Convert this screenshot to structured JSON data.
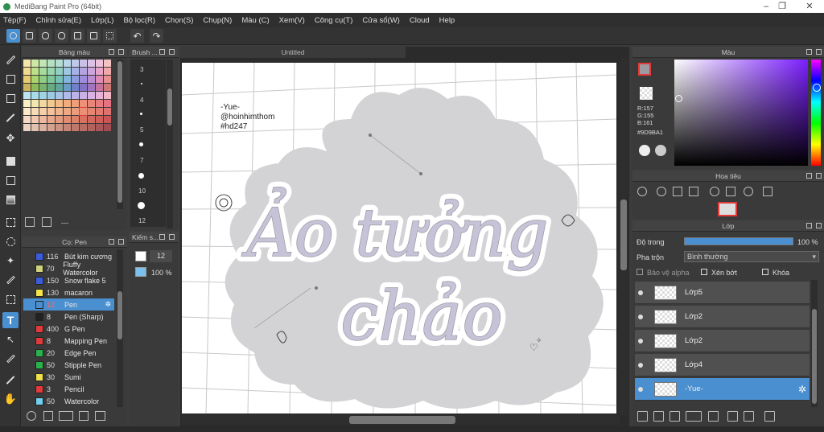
{
  "app": {
    "title": "MediBang Paint Pro (64bit)"
  },
  "menu": [
    "Tệp(F)",
    "Chỉnh sửa(E)",
    "Lớp(L)",
    "Bộ lọc(R)",
    "Chọn(S)",
    "Chụp(N)",
    "Màu (C)",
    "Xem(V)",
    "Công cụ(T)",
    "Cửa sổ(W)",
    "Cloud",
    "Help"
  ],
  "palette": {
    "title": "Bảng màu",
    "footer": "---",
    "colors": [
      "#f3e6a8",
      "#cde8a5",
      "#c1e6b5",
      "#b7e0c3",
      "#b2ddd0",
      "#b9d7e8",
      "#c0c8ea",
      "#cbc0e8",
      "#dcc0e6",
      "#efc2dc",
      "#f6c3c3",
      "#eedb8e",
      "#bfe08a",
      "#a6dc9c",
      "#98d6ae",
      "#92d0c3",
      "#9dc8e3",
      "#a4b2e6",
      "#b4a3e2",
      "#cda5dd",
      "#e7a5c9",
      "#f1a8a8",
      "#e5cc70",
      "#a9d46e",
      "#8ccf84",
      "#7ec79b",
      "#76c2b5",
      "#82b7dd",
      "#8d9ce0",
      "#9e8ddc",
      "#ba8dd3",
      "#dd8cb6",
      "#e88f8f",
      "#c8b45c",
      "#8dbb5a",
      "#77b46d",
      "#67ab83",
      "#5fa69c",
      "#6a9cc4",
      "#7181c9",
      "#8473c4",
      "#a174bd",
      "#c4749f",
      "#d07878",
      "#b9e4f0",
      "#a9dcea",
      "#a0d4e4",
      "#9ccce3",
      "#a6c3e8",
      "#afb9ea",
      "#bbb3ea",
      "#c9b0e6",
      "#d9b1e2",
      "#e8b3d8",
      "#f2b8c8",
      "#f7f0c2",
      "#f3e6b0",
      "#f2d89f",
      "#f2c98f",
      "#f3ba84",
      "#f2ab7c",
      "#f09d78",
      "#ed9178",
      "#ea857a",
      "#e87b7d",
      "#e57183",
      "#fbe9c8",
      "#f8dcb8",
      "#f6cfa9",
      "#f4c29b",
      "#f1b58e",
      "#efa884",
      "#ec9c7c",
      "#ea9076",
      "#e78572",
      "#e47b70",
      "#e17170",
      "#f6d8c4",
      "#f2c8b0",
      "#eeb89e",
      "#eaa98d",
      "#e69a7e",
      "#e28c72",
      "#de7f68",
      "#d97361",
      "#d5685c",
      "#d05e59",
      "#cb5457",
      "#ead1c2",
      "#e3c1b0",
      "#dcb19f",
      "#d5a290",
      "#ce9382",
      "#c78576",
      "#c0786c",
      "#b96c64",
      "#b2615d",
      "#ab5658",
      "#a44c54"
    ]
  },
  "brush_size": {
    "title": "Brush ...",
    "sizes": [
      "3",
      "4",
      "5",
      "7",
      "10",
      "12"
    ]
  },
  "pens": {
    "title": "Cọ: Pen",
    "items": [
      {
        "size": "116",
        "name": "Bút kim cương",
        "color": "#3a5ce0"
      },
      {
        "size": "70",
        "name": "Fluffy Watercolor",
        "color": "#d0d37a"
      },
      {
        "size": "150",
        "name": "Snow flake 5",
        "color": "#3a5ce0"
      },
      {
        "size": "130",
        "name": "macaron",
        "color": "#f5e54a"
      },
      {
        "size": "12",
        "name": "Pen",
        "color": "#4a8fd0"
      },
      {
        "size": "8",
        "name": "Pen (Sharp)",
        "color": "#222222"
      },
      {
        "size": "400",
        "name": "G Pen",
        "color": "#e23a3a"
      },
      {
        "size": "8",
        "name": "Mapping Pen",
        "color": "#e23a3a"
      },
      {
        "size": "20",
        "name": "Edge Pen",
        "color": "#27b24a"
      },
      {
        "size": "50",
        "name": "Stipple Pen",
        "color": "#27b24a"
      },
      {
        "size": "30",
        "name": "Sumi",
        "color": "#f0e14a"
      },
      {
        "size": "3",
        "name": "Pencil",
        "color": "#e23a3a"
      },
      {
        "size": "50",
        "name": "Watercolor",
        "color": "#6fd0f0"
      }
    ]
  },
  "stroke": {
    "title": "Kiếm s...",
    "size": "12",
    "opacity": "100 %"
  },
  "canvas": {
    "tab": "Untitled",
    "credit1": "-Yue-",
    "credit2": "@hoinhimthom",
    "credit3": "#hd247",
    "line1": "Ảo tưởng",
    "line2": "chảo"
  },
  "color": {
    "title": "Màu",
    "r": "R:157",
    "g": "G:155",
    "b": "B:161",
    "hex": "#9D9BA1",
    "current": "#9D9BA1"
  },
  "navigator": {
    "title": "Hoa tiêu"
  },
  "layers": {
    "title": "Lớp",
    "opacity_label": "Độ trong",
    "opacity_value": "100 %",
    "blend_label": "Pha trộn",
    "blend_value": "Bình thường",
    "protect_alpha": "Bảo vệ alpha",
    "clip": "Xén bớt",
    "lock": "Khóa",
    "items": [
      "Lớp5",
      "Lớp2",
      "Lớp2",
      "Lớp4",
      "-Yue-"
    ]
  }
}
